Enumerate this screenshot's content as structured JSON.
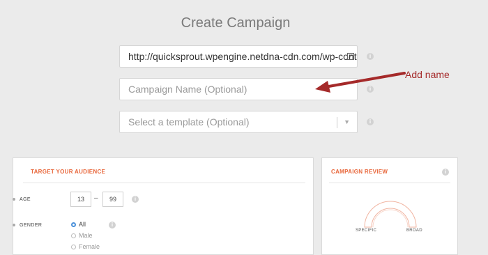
{
  "page_title": "Create Campaign",
  "url_field": {
    "value": "http://quicksprout.wpengine.netdna-cdn.com/wp-cont"
  },
  "name_field": {
    "placeholder": "Campaign Name (Optional)"
  },
  "template_select": {
    "placeholder": "Select a template (Optional)",
    "caret": "▼"
  },
  "info_glyph": "i",
  "annotation": "Add name",
  "audience": {
    "heading": "TARGET YOUR AUDIENCE",
    "age_label": "AGE",
    "age_min": "13",
    "age_sep": "–",
    "age_max": "99",
    "gender_label": "GENDER",
    "gender_options": [
      "All",
      "Male",
      "Female"
    ],
    "gender_selected": "All"
  },
  "review": {
    "heading": "CAMPAIGN REVIEW",
    "specific_label": "SPECIFIC",
    "broad_label": "BROAD"
  },
  "colors": {
    "accent": "#e8663a",
    "annotation": "#a52a2a",
    "radio_selected": "#4a90d9"
  },
  "icons": [
    "info-icon",
    "external-link-icon",
    "chevron-down-icon",
    "arrow-annotation-icon"
  ]
}
